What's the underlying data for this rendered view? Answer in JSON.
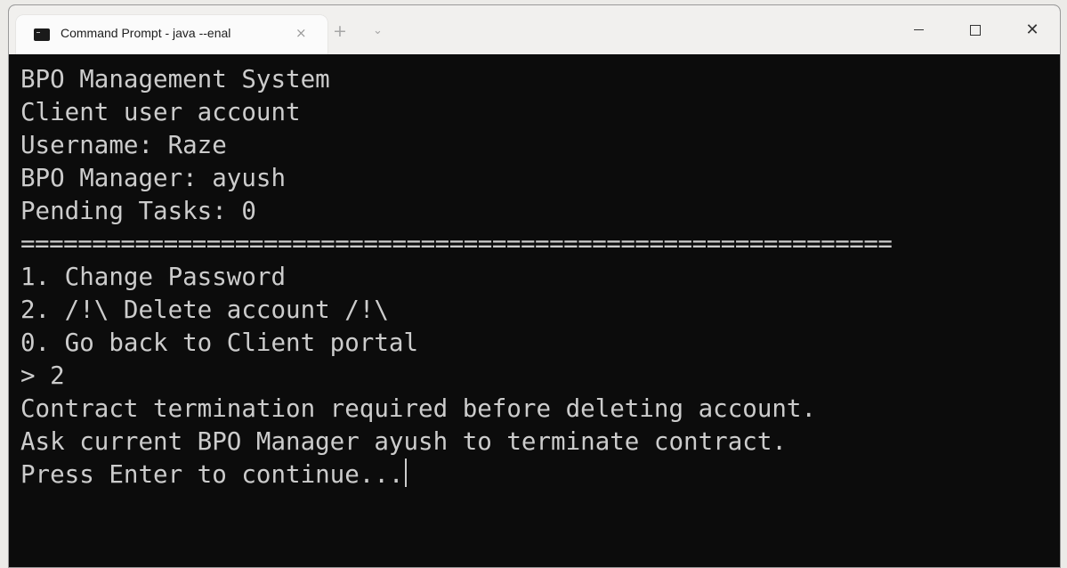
{
  "window": {
    "tab_title": "Command Prompt - java  --enal",
    "tab_close": "×",
    "new_tab": "+",
    "tab_dropdown": "⌄",
    "minimize_icon": "minimize-icon",
    "maximize_icon": "maximize-icon",
    "close_glyph": "✕"
  },
  "terminal": {
    "lines": [
      "BPO Management System",
      "Client user account",
      "Username: Raze",
      "BPO Manager: ayush",
      "Pending Tasks: 0",
      "=============================================================",
      "1. Change Password",
      "2. /!\\ Delete account /!\\",
      "0. Go back to Client portal",
      "> 2",
      "Contract termination required before deleting account.",
      "Ask current BPO Manager ayush to terminate contract.",
      "Press Enter to continue..."
    ]
  },
  "colors": {
    "terminal_bg": "#0c0c0c",
    "terminal_fg": "#cccccc",
    "titlebar_bg": "#f1f0ee",
    "tab_bg": "#fbfbfb"
  }
}
